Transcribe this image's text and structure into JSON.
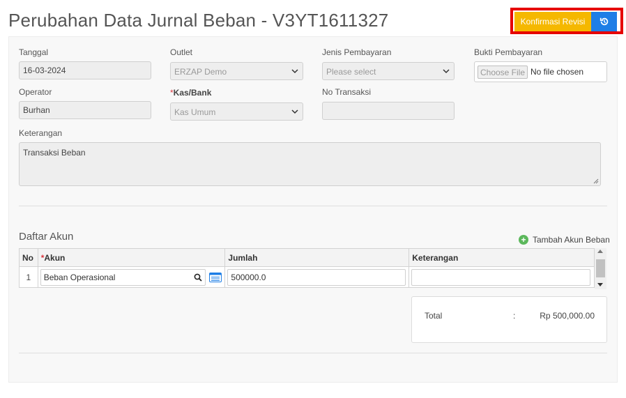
{
  "page": {
    "title": "Perubahan Data Jurnal Beban - V3YT1611327"
  },
  "actions": {
    "confirm_label": "Konfirmasi Revisi",
    "history_icon": "history-icon"
  },
  "form": {
    "tanggal": {
      "label": "Tanggal",
      "value": "16-03-2024"
    },
    "outlet": {
      "label": "Outlet",
      "value": "ERZAP Demo"
    },
    "jenis_pembayaran": {
      "label": "Jenis Pembayaran",
      "placeholder": "Please select"
    },
    "bukti_pembayaran": {
      "label": "Bukti Pembayaran",
      "button": "Choose File",
      "status": "No file chosen"
    },
    "operator": {
      "label": "Operator",
      "value": "Burhan"
    },
    "kas_bank": {
      "required_mark": "*",
      "label": "Kas/Bank",
      "value": "Kas Umum"
    },
    "no_transaksi": {
      "label": "No Transaksi",
      "value": ""
    },
    "keterangan": {
      "label": "Keterangan",
      "value": "Transaksi Beban"
    }
  },
  "accounts": {
    "title": "Daftar Akun",
    "add_label": "Tambah Akun Beban",
    "columns": {
      "no": "No",
      "akun_mark": "*",
      "akun": "Akun",
      "jumlah": "Jumlah",
      "keterangan": "Keterangan"
    },
    "rows": [
      {
        "no": "1",
        "akun": "Beban Operasional",
        "jumlah": "500000.0",
        "keterangan": ""
      }
    ]
  },
  "total": {
    "label": "Total",
    "separator": ":",
    "value": "Rp 500,000.00"
  },
  "colors": {
    "confirm": "#f5b800",
    "history": "#1e7ee6",
    "highlight": "#e60000",
    "add": "#5cb85c"
  }
}
